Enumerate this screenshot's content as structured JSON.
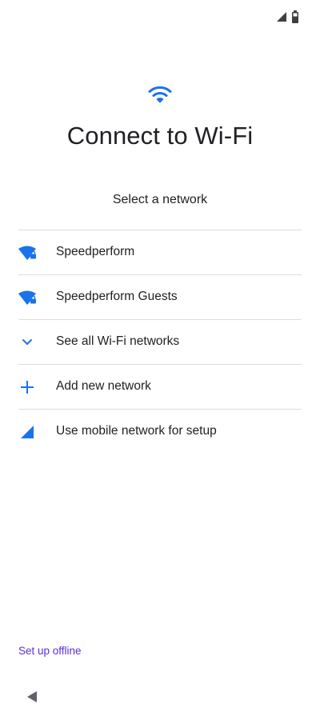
{
  "screen": {
    "title": "Connect to Wi-Fi",
    "subtitle": "Select a network"
  },
  "list": {
    "items": [
      {
        "label": "Speedperform",
        "icon": "wifi-lock-icon"
      },
      {
        "label": "Speedperform Guests",
        "icon": "wifi-lock-icon"
      },
      {
        "label": "See all Wi-Fi networks",
        "icon": "chevron-down-icon"
      },
      {
        "label": "Add new network",
        "icon": "plus-icon"
      },
      {
        "label": "Use mobile network for setup",
        "icon": "cellular-signal-icon"
      }
    ]
  },
  "footer": {
    "offline_label": "Set up offline"
  },
  "colors": {
    "accent": "#1a73e8",
    "link": "#5b2fd6",
    "divider": "#dadce0",
    "text": "#202124"
  }
}
